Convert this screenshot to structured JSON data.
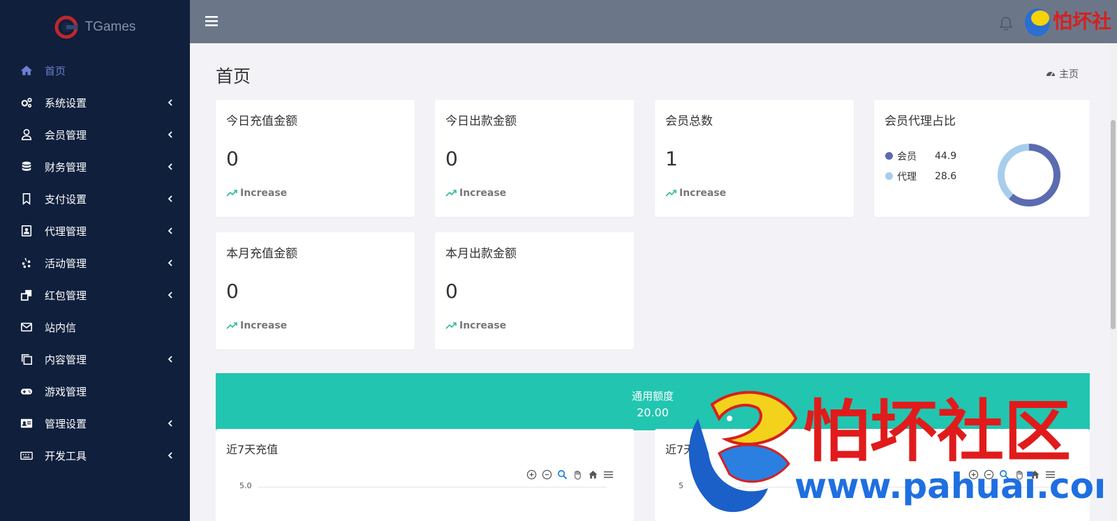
{
  "app": {
    "brand": "TGames"
  },
  "sidebar": {
    "items": [
      {
        "label": "首页",
        "icon": "home-icon",
        "active": true,
        "has_children": false
      },
      {
        "label": "系统设置",
        "icon": "gears-icon",
        "has_children": true
      },
      {
        "label": "会员管理",
        "icon": "user-icon",
        "has_children": true
      },
      {
        "label": "财务管理",
        "icon": "database-icon",
        "has_children": true
      },
      {
        "label": "支付设置",
        "icon": "bookmark-icon",
        "has_children": true
      },
      {
        "label": "代理管理",
        "icon": "contact-card-icon",
        "has_children": true
      },
      {
        "label": "活动管理",
        "icon": "yelp-icon",
        "has_children": true
      },
      {
        "label": "红包管理",
        "icon": "clone-icon",
        "has_children": true
      },
      {
        "label": "站内信",
        "icon": "envelope-icon",
        "has_children": false
      },
      {
        "label": "内容管理",
        "icon": "copy-icon",
        "has_children": true
      },
      {
        "label": "游戏管理",
        "icon": "gamepad-icon",
        "has_children": false
      },
      {
        "label": "管理设置",
        "icon": "id-card-icon",
        "has_children": true
      },
      {
        "label": "开发工具",
        "icon": "keyboard-icon",
        "has_children": true
      }
    ]
  },
  "header": {
    "page_title": "首页",
    "breadcrumb": "主页"
  },
  "stats": [
    {
      "title": "今日充值金额",
      "value": "0",
      "trend": "Increase"
    },
    {
      "title": "今日出款金额",
      "value": "0",
      "trend": "Increase"
    },
    {
      "title": "会员总数",
      "value": "1",
      "trend": "Increase"
    },
    {
      "title": "本月充值金额",
      "value": "0",
      "trend": "Increase"
    },
    {
      "title": "本月出款金额",
      "value": "0",
      "trend": "Increase"
    }
  ],
  "ratio_card": {
    "title": "会员代理占比",
    "legend": [
      {
        "label": "会员",
        "value": "44.9",
        "color": "#5b6bb0"
      },
      {
        "label": "代理",
        "value": "28.6",
        "color": "#a8cdec"
      }
    ]
  },
  "quota": {
    "label": "通用额度",
    "value": "20.00",
    "color": "#22c5b0"
  },
  "charts": [
    {
      "title": "近7天充值",
      "y_tick": "5.0"
    },
    {
      "title": "近7天提",
      "y_tick": "5"
    }
  ],
  "watermark": {
    "name": "怕坏社区",
    "url": "www.pahuai.com"
  },
  "colors": {
    "sidebar_bg": "#0f1f3c",
    "topbar_bg": "#6b7789",
    "accent": "#6d7fd0",
    "trend_green": "#2fb99a"
  }
}
